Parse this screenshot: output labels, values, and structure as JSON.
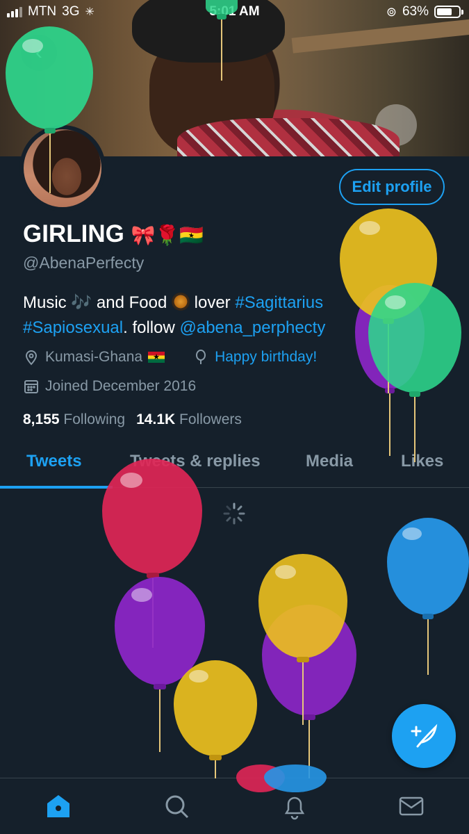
{
  "status_bar": {
    "carrier": "MTN",
    "network": "3G",
    "time": "5:01 AM",
    "battery": "63%"
  },
  "profile": {
    "name": "GIRLING",
    "name_emojis": "🎀🌹🇬🇭",
    "handle": "@AbenaPerfecty",
    "edit_profile_label": "Edit profile",
    "bio": {
      "part1": "Music ",
      "note_emoji": "🎶",
      "part2": " and Food ",
      "part3": " lover ",
      "hashtag1": "#Sagittarius",
      "hashtag2": "#Sapiosexual",
      "part4": ". follow ",
      "mention": "@abena_perphecty"
    },
    "location": "Kumasi-Ghana",
    "birthday": "Happy birthday!",
    "joined": "Joined December 2016",
    "following_count": "8,155",
    "following_label": "Following",
    "followers_count": "14.1K",
    "followers_label": "Followers"
  },
  "tabs": [
    {
      "label": "Tweets",
      "active": true
    },
    {
      "label": "Tweets & replies",
      "active": false
    },
    {
      "label": "Media",
      "active": false
    },
    {
      "label": "Likes",
      "active": false
    }
  ],
  "bottom_nav": [
    "home-icon",
    "search-icon",
    "bell-icon",
    "mail-icon"
  ],
  "colors": {
    "background": "#15202b",
    "accent": "#1da1f2",
    "secondary_text": "#8899a6",
    "divider": "#38444d"
  }
}
